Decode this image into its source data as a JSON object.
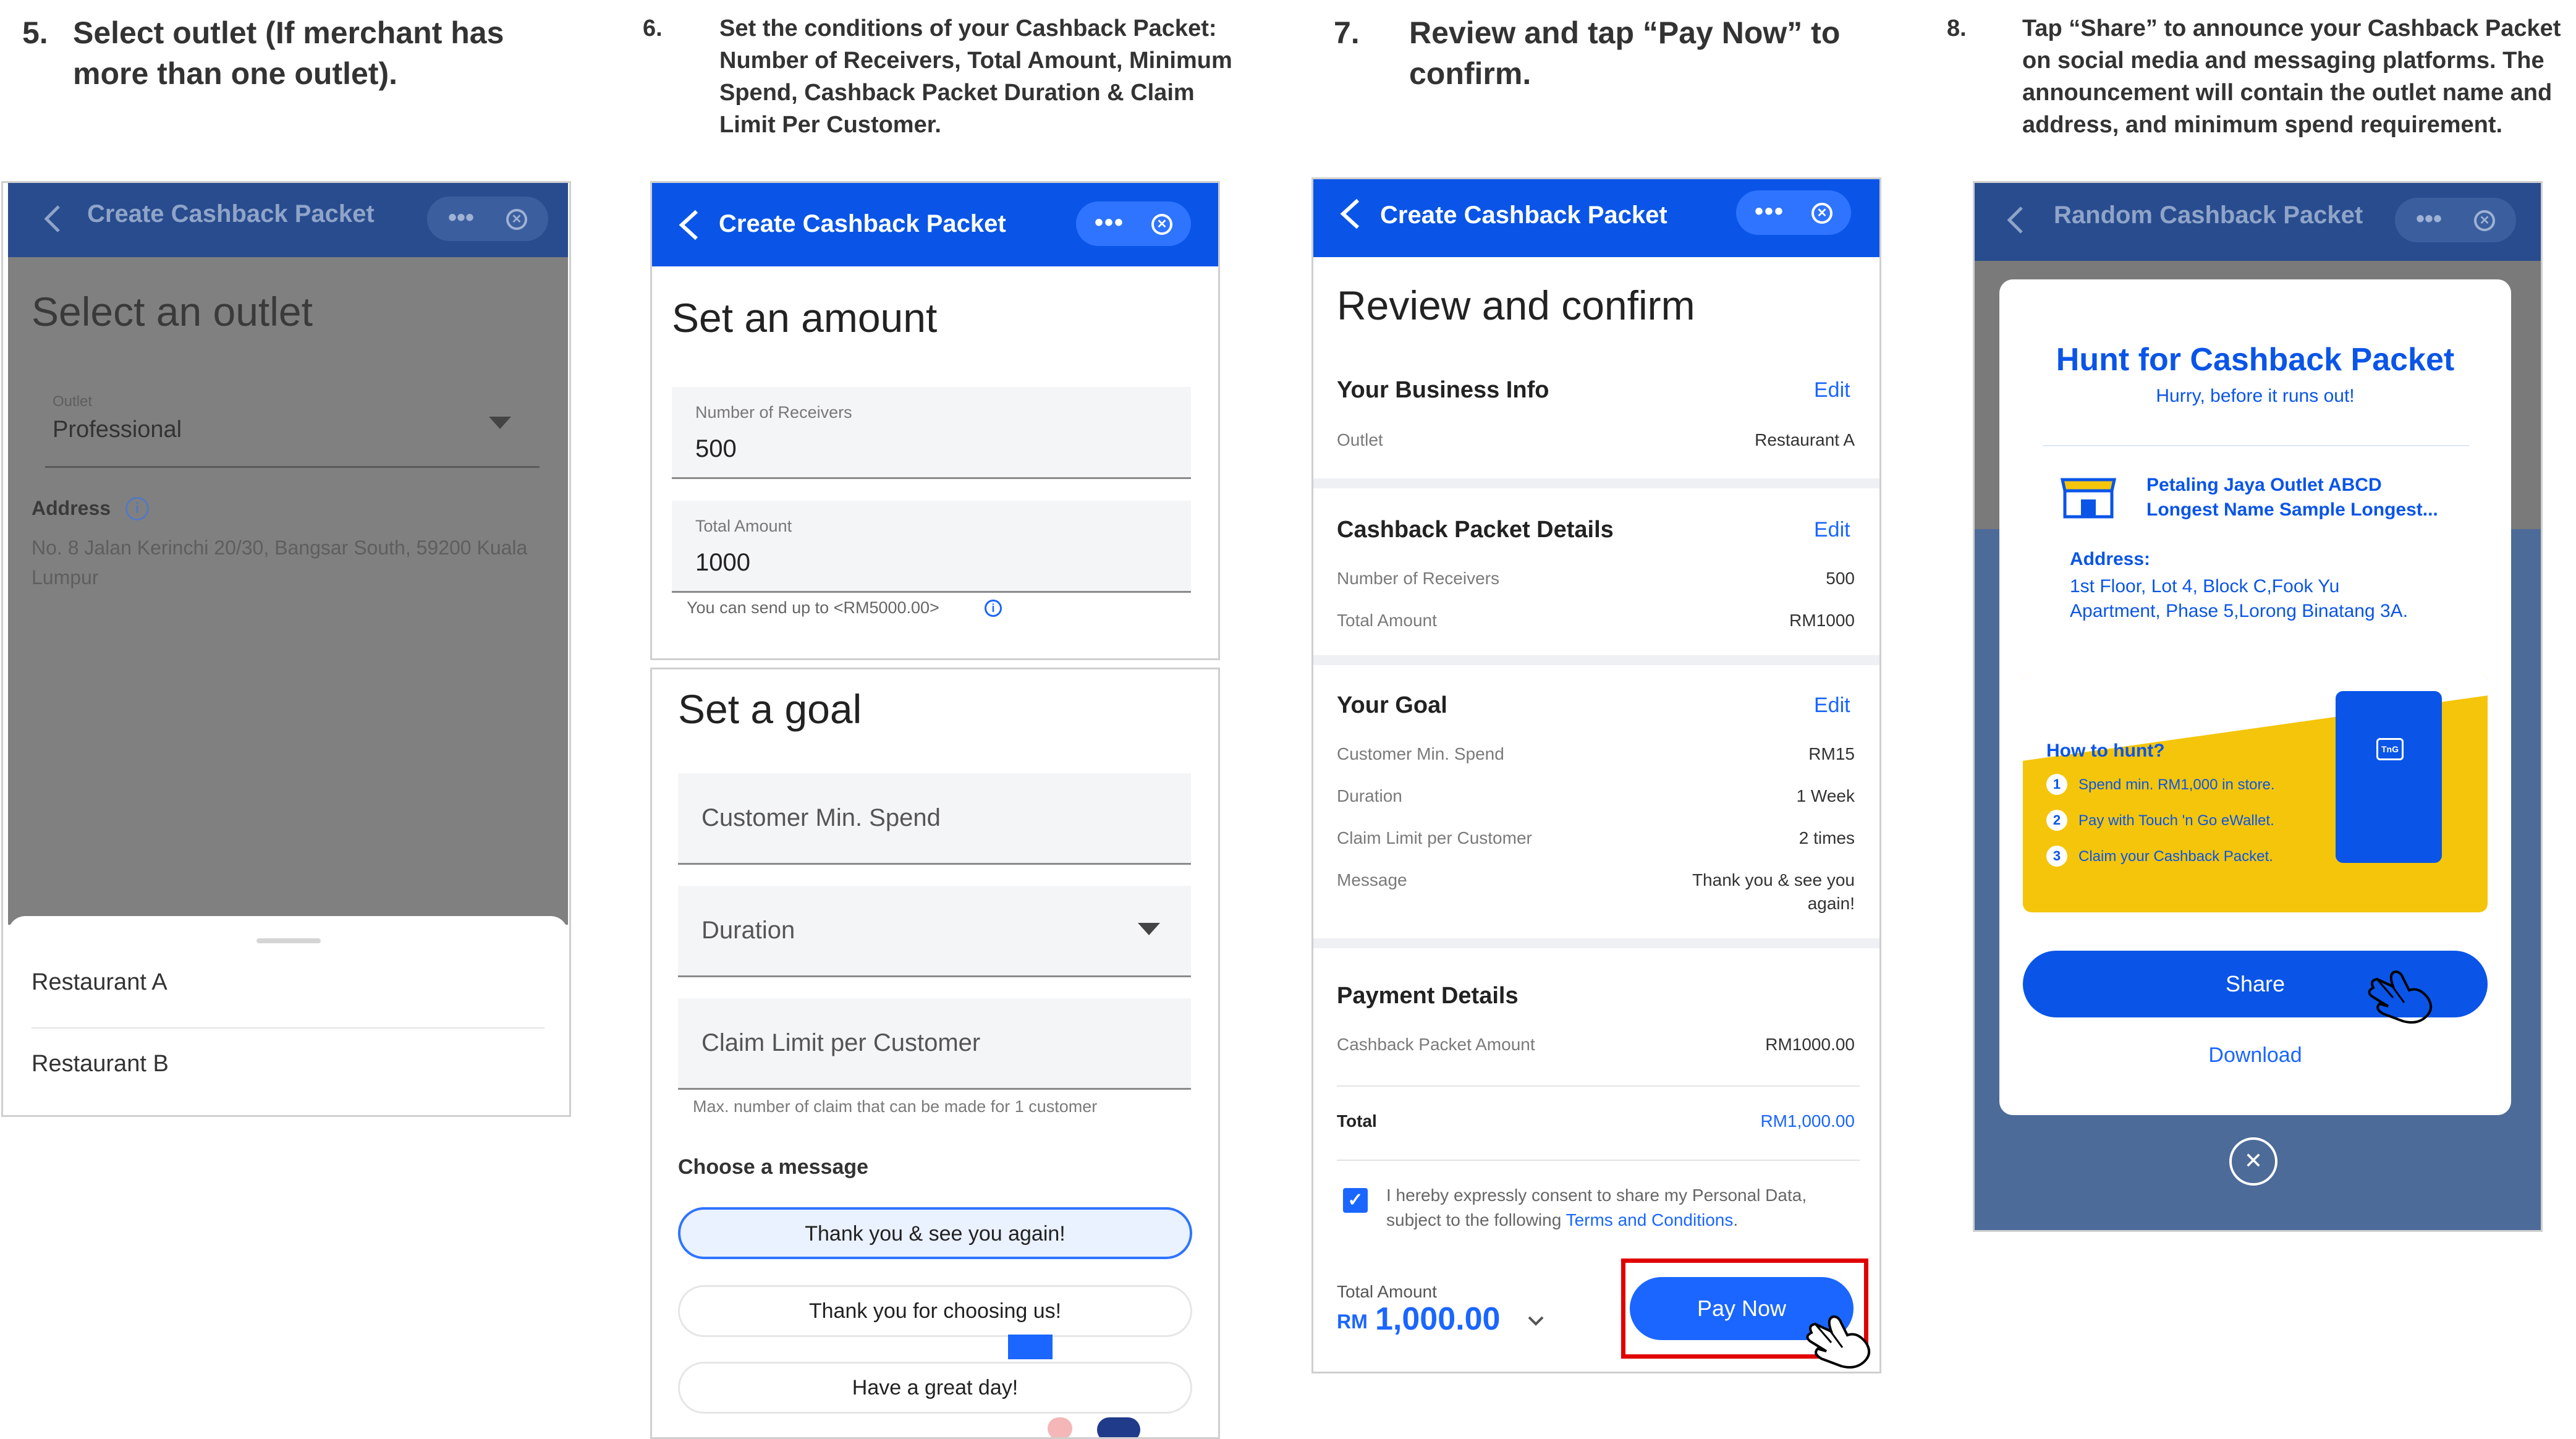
{
  "steps": {
    "s5": {
      "num": "5.",
      "text": "Select outlet (If merchant has more than one outlet)."
    },
    "s6": {
      "num": "6.",
      "text": "Set the conditions of your Cashback Packet: Number of Receivers, Total Amount, Minimum Spend, Cashback Packet Duration & Claim Limit Per Customer."
    },
    "s7": {
      "num": "7.",
      "text": "Review and tap “Pay Now” to confirm."
    },
    "s8": {
      "num": "8.",
      "text": "Tap “Share” to announce your Cashback Packet on social media and messaging platforms. The announcement will contain the outlet name and address, and minimum spend requirement."
    }
  },
  "screen1": {
    "title": "Create Cashback Packet",
    "heading": "Select an outlet",
    "outlet_label": "Outlet",
    "outlet_value": "Professional",
    "address_label": "Address",
    "address_value": "No. 8 Jalan Kerinchi 20/30, Bangsar South, 59200 Kuala Lumpur",
    "options": [
      "Restaurant A",
      "Restaurant B"
    ]
  },
  "screen2": {
    "title": "Create Cashback Packet",
    "amount_heading": "Set an amount",
    "receivers_label": "Number of Receivers",
    "receivers_value": "500",
    "total_label": "Total Amount",
    "total_value": "1000",
    "hint": "You can send up to <RM5000.00>",
    "goal_heading": "Set a goal",
    "min_spend_placeholder": "Customer Min. Spend",
    "duration_placeholder": "Duration",
    "claim_placeholder": "Claim Limit per Customer",
    "claim_hint": "Max. number of claim that can be made for 1 customer",
    "message_heading": "Choose a message",
    "messages": [
      "Thank you & see you again!",
      "Thank you for choosing us!",
      "Have a great day!"
    ]
  },
  "screen3": {
    "title": "Create Cashback Packet",
    "heading": "Review and confirm",
    "edit_label": "Edit",
    "business": {
      "title": "Your Business Info",
      "rows": [
        {
          "label": "Outlet",
          "value": "Restaurant A"
        }
      ]
    },
    "details": {
      "title": "Cashback Packet Details",
      "rows": [
        {
          "label": "Number of Receivers",
          "value": "500"
        },
        {
          "label": "Total Amount",
          "value": "RM1000"
        }
      ]
    },
    "goal": {
      "title": "Your Goal",
      "rows": [
        {
          "label": "Customer Min. Spend",
          "value": "RM15"
        },
        {
          "label": "Duration",
          "value": "1 Week"
        },
        {
          "label": "Claim Limit per Customer",
          "value": "2 times"
        }
      ],
      "message_label": "Message",
      "message_value_1": "Thank you & see you",
      "message_value_2": "again!"
    },
    "payment": {
      "title": "Payment Details",
      "amount_label": "Cashback Packet Amount",
      "amount_value": "RM1000.00",
      "total_label": "Total",
      "total_value": "RM1,000.00"
    },
    "consent_1": "I hereby expressly consent to share my Personal Data,",
    "consent_2": "subject to the following ",
    "consent_link": "Terms and Conditions",
    "consent_end": ".",
    "footer_label": "Total Amount",
    "footer_currency": "RM",
    "footer_amount": "1,000.00",
    "pay_button": "Pay Now"
  },
  "screen4": {
    "title": "Random Cashback Packet",
    "card_title": "Hunt for Cashback Packet",
    "card_subtitle": "Hurry, before it runs out!",
    "outlet_line_1": "Petaling Jaya Outlet ABCD",
    "outlet_line_2": "Longest Name Sample Longest...",
    "address_label": "Address:",
    "address_line_1": "1st Floor, Lot 4, Block C,Fook Yu",
    "address_line_2": "Apartment, Phase 5,Lorong Binatang 3A.",
    "how_title": "How to hunt?",
    "steps": [
      "Spend min. RM1,000 in store.",
      "Pay with Touch 'n Go eWallet.",
      "Claim your Cashback Packet."
    ],
    "packet_logo": "TnG",
    "share_button": "Share",
    "download_link": "Download"
  },
  "colors": {
    "brand_blue": "#0a55e8",
    "accent_blue": "#1a66ff",
    "yellow": "#f4c50a",
    "highlight_red": "#e00000"
  }
}
